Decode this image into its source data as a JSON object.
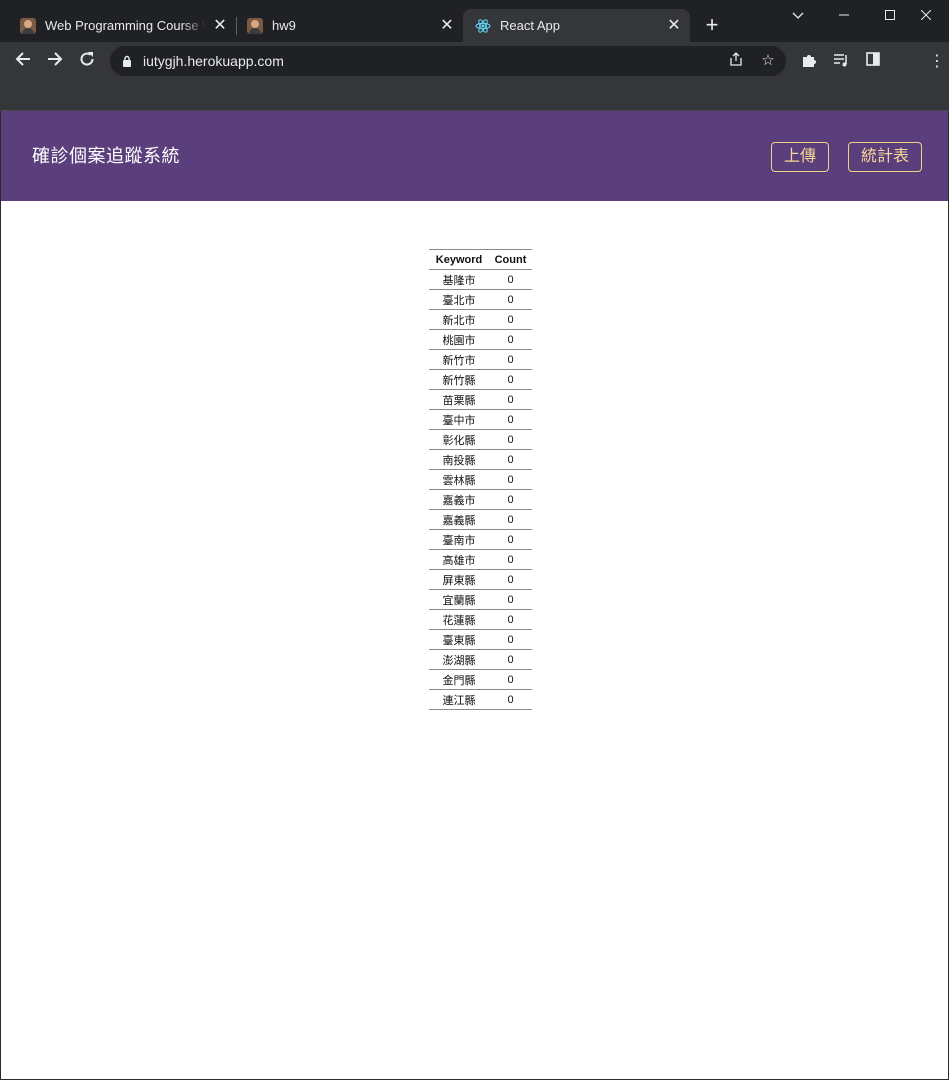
{
  "browser": {
    "tabs": [
      {
        "title": "Web Programming Course Website",
        "favicon": "person-photo-icon",
        "active": false
      },
      {
        "title": "hw9",
        "favicon": "person-photo-icon",
        "active": false
      },
      {
        "title": "React App",
        "favicon": "react-logo-icon",
        "active": true
      }
    ],
    "new_tab_label": "+",
    "url": "iutygjh.herokuapp.com"
  },
  "app": {
    "title": "確診個案追蹤系統",
    "upload_label": "上傳",
    "stats_label": "統計表",
    "accent_color": "#5b3f7c",
    "button_color": "#f6d797"
  },
  "table": {
    "headers": {
      "keyword": "Keyword",
      "count": "Count"
    },
    "rows": [
      {
        "keyword": "基隆市",
        "count": "0"
      },
      {
        "keyword": "臺北市",
        "count": "0"
      },
      {
        "keyword": "新北市",
        "count": "0"
      },
      {
        "keyword": "桃園市",
        "count": "0"
      },
      {
        "keyword": "新竹市",
        "count": "0"
      },
      {
        "keyword": "新竹縣",
        "count": "0"
      },
      {
        "keyword": "苗栗縣",
        "count": "0"
      },
      {
        "keyword": "臺中市",
        "count": "0"
      },
      {
        "keyword": "彰化縣",
        "count": "0"
      },
      {
        "keyword": "南投縣",
        "count": "0"
      },
      {
        "keyword": "雲林縣",
        "count": "0"
      },
      {
        "keyword": "嘉義市",
        "count": "0"
      },
      {
        "keyword": "嘉義縣",
        "count": "0"
      },
      {
        "keyword": "臺南市",
        "count": "0"
      },
      {
        "keyword": "高雄市",
        "count": "0"
      },
      {
        "keyword": "屏東縣",
        "count": "0"
      },
      {
        "keyword": "宜蘭縣",
        "count": "0"
      },
      {
        "keyword": "花蓮縣",
        "count": "0"
      },
      {
        "keyword": "臺東縣",
        "count": "0"
      },
      {
        "keyword": "澎湖縣",
        "count": "0"
      },
      {
        "keyword": "金門縣",
        "count": "0"
      },
      {
        "keyword": "連江縣",
        "count": "0"
      }
    ]
  }
}
